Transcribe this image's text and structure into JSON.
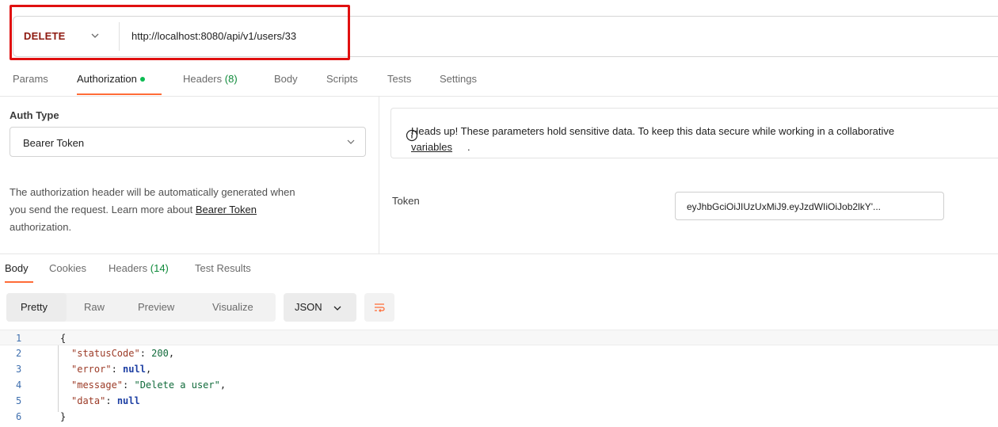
{
  "request": {
    "method": "DELETE",
    "url": "http://localhost:8080/api/v1/users/33"
  },
  "request_tabs": {
    "params": "Params",
    "authorization": "Authorization",
    "headers": "Headers",
    "headers_count": "(8)",
    "body": "Body",
    "scripts": "Scripts",
    "tests": "Tests",
    "settings": "Settings"
  },
  "auth": {
    "type_label": "Auth Type",
    "type_value": "Bearer Token",
    "desc_1": "The authorization header will be automatically generated when",
    "desc_2": "you send the request. Learn more about",
    "desc_link": "Bearer Token",
    "desc_3": "authorization.",
    "notice_text": "Heads up! These parameters hold sensitive data. To keep this data secure while working in a collaborative",
    "notice_link": "variables",
    "notice_period": ".",
    "token_label": "Token",
    "token_value": "eyJhbGciOiJIUzUxMiJ9.eyJzdWIiOiJob2lkY'..."
  },
  "response_tabs": {
    "body": "Body",
    "cookies": "Cookies",
    "headers": "Headers",
    "headers_count": "(14)",
    "test_results": "Test Results"
  },
  "view": {
    "pretty": "Pretty",
    "raw": "Raw",
    "preview": "Preview",
    "visualize": "Visualize",
    "format": "JSON"
  },
  "code": {
    "line_numbers": [
      "1",
      "2",
      "3",
      "4",
      "5",
      "6"
    ],
    "open_brace": "{",
    "close_brace": "}",
    "k_status": "\"statusCode\"",
    "v_status": "200",
    "k_error": "\"error\"",
    "v_error": "null",
    "k_message": "\"message\"",
    "v_message": "\"Delete a user\"",
    "k_data": "\"data\"",
    "v_data": "null",
    "colon": ": ",
    "comma": ","
  },
  "colors": {
    "method": "#8e1a10",
    "accent": "#ff6c37",
    "success": "#0cbb52",
    "highlight_box": "#e01010"
  }
}
